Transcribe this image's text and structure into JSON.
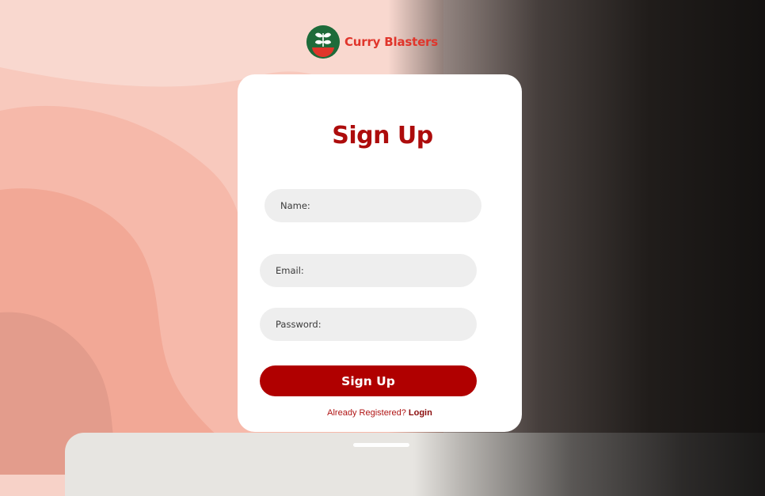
{
  "brand": {
    "name": "Curry Blasters",
    "logo_icon": "leaf-bowl-icon",
    "colors": {
      "brand_red": "#e0352b",
      "brand_green": "#1e6b3a"
    }
  },
  "form": {
    "title": "Sign Up",
    "fields": {
      "name_label": "Name:",
      "email_label": "Email:",
      "password_label": "Password:"
    },
    "submit_label": "Sign Up",
    "accent": "#b00000"
  },
  "footer": {
    "prompt": "Already Registered?",
    "login_label": "Login"
  }
}
